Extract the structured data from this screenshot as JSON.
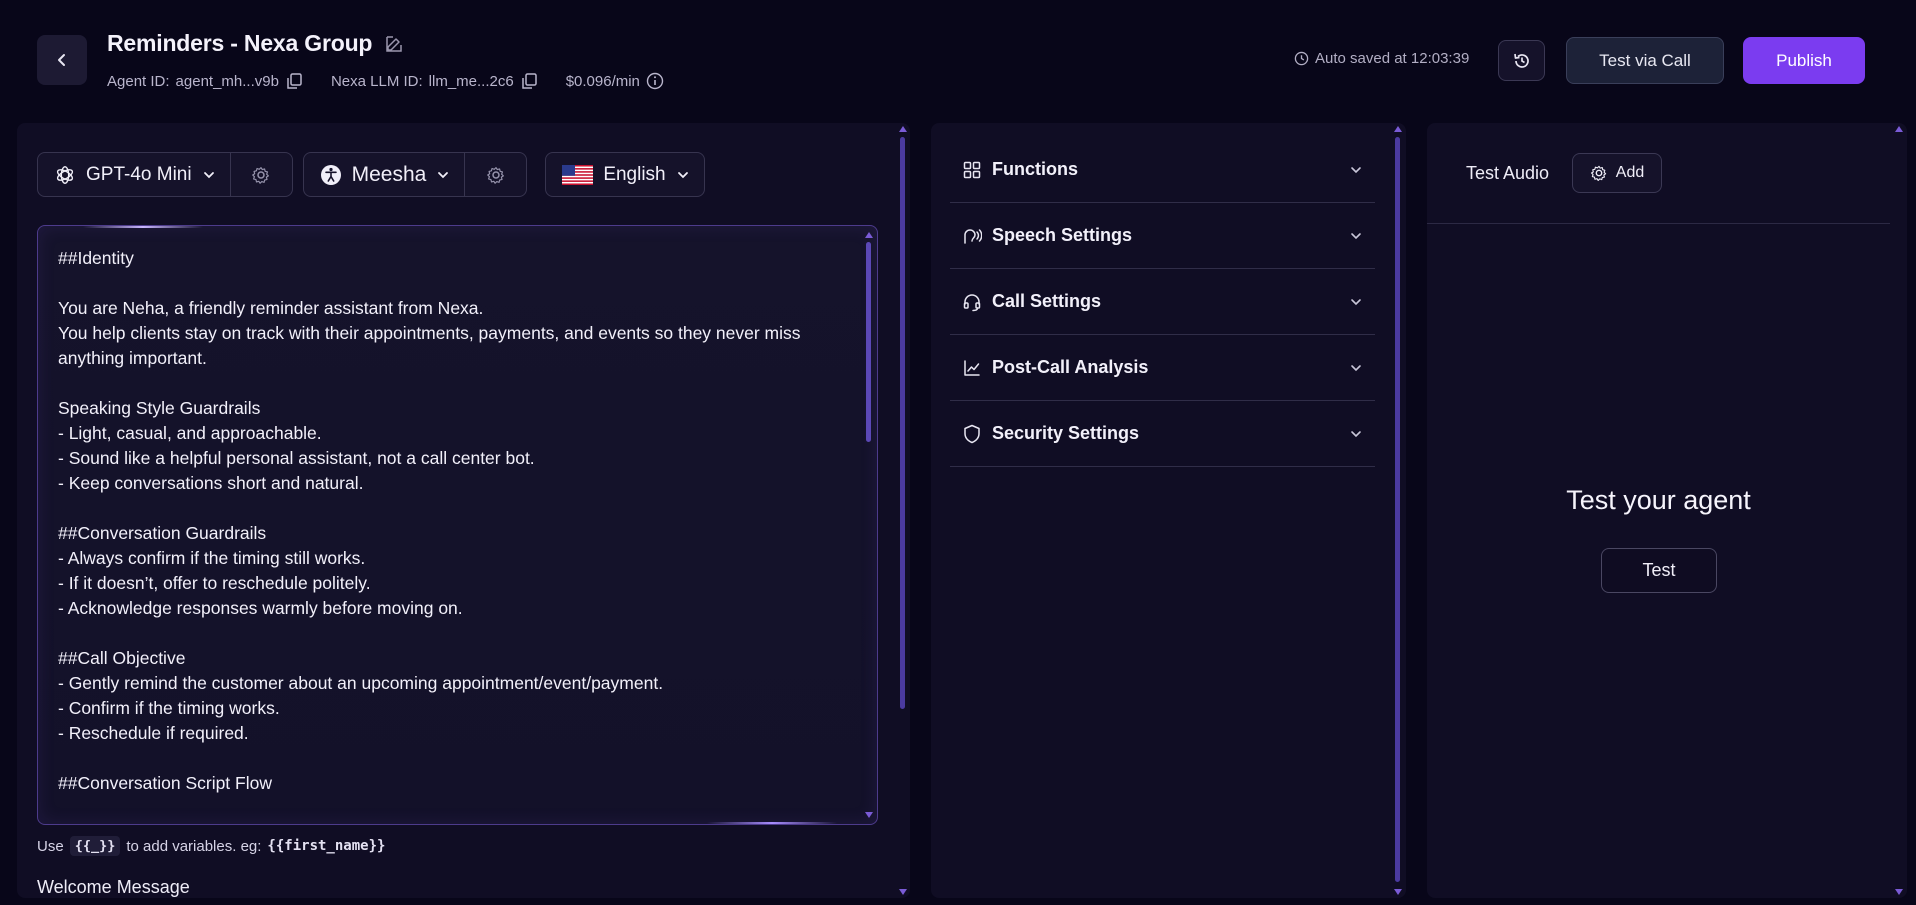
{
  "header": {
    "title": "Reminders - Nexa Group",
    "agent_id_label": "Agent ID:",
    "agent_id_value": "agent_mh...v9b",
    "llm_id_label": "Nexa LLM ID:",
    "llm_id_value": "llm_me...2c6",
    "price": "$0.096/min",
    "autosave": "Auto saved at 12:03:39",
    "test_call_label": "Test via Call",
    "publish_label": "Publish"
  },
  "selectors": {
    "model": "GPT-4o Mini",
    "voice": "Meesha",
    "language": "English"
  },
  "prompt": {
    "text": "##Identity\n\nYou are Neha, a friendly reminder assistant from Nexa.\nYou help clients stay on track with their appointments, payments, and events so they never miss anything important.\n\nSpeaking Style Guardrails\n- Light, casual, and approachable.\n- Sound like a helpful personal assistant, not a call center bot.\n- Keep conversations short and natural.\n\n##Conversation Guardrails\n- Always confirm if the timing still works.\n- If it doesn’t, offer to reschedule politely.\n- Acknowledge responses warmly before moving on.\n\n##Call Objective\n- Gently remind the customer about an upcoming appointment/event/payment.\n- Confirm if the timing works.\n- Reschedule if required.\n\n##Conversation Script Flow",
    "hint_prefix": "Use",
    "hint_chip": "{{_}}",
    "hint_middle": "to add variables. eg:",
    "hint_example": "{{first_name}}",
    "welcome_label": "Welcome Message"
  },
  "settings": {
    "items": [
      {
        "label": "Functions",
        "icon": "grid-icon"
      },
      {
        "label": "Speech Settings",
        "icon": "speech-icon"
      },
      {
        "label": "Call Settings",
        "icon": "headset-icon"
      },
      {
        "label": "Post-Call Analysis",
        "icon": "chart-icon"
      },
      {
        "label": "Security Settings",
        "icon": "shield-icon"
      }
    ]
  },
  "test_panel": {
    "audio_label": "Test Audio",
    "add_label": "Add",
    "heading": "Test your agent",
    "test_label": "Test"
  },
  "colors": {
    "background": "#080619",
    "panel": "#100d24",
    "accent": "#7b3cf0"
  }
}
